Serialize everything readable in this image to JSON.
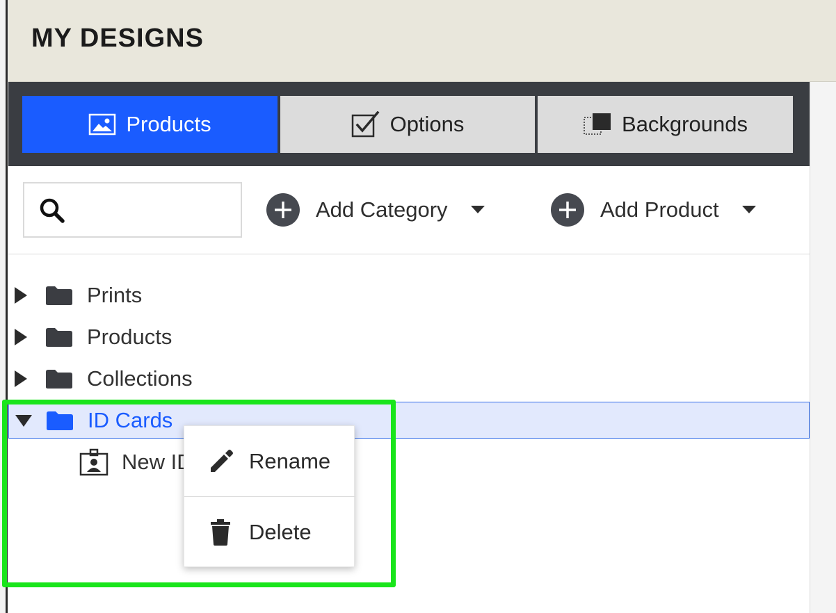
{
  "header": {
    "title": "MY DESIGNS"
  },
  "tabs": [
    {
      "label": "Products",
      "icon": "image-icon",
      "active": true
    },
    {
      "label": "Options",
      "icon": "checkbox-icon",
      "active": false
    },
    {
      "label": "Backgrounds",
      "icon": "layers-icon",
      "active": false
    }
  ],
  "toolbar": {
    "search": {
      "placeholder": "",
      "value": ""
    },
    "add_category_label": "Add Category",
    "add_product_label": "Add Product"
  },
  "tree": {
    "items": [
      {
        "label": "Prints",
        "expanded": false,
        "selected": false
      },
      {
        "label": "Products",
        "expanded": false,
        "selected": false
      },
      {
        "label": "Collections",
        "expanded": false,
        "selected": false
      },
      {
        "label": "ID Cards",
        "expanded": true,
        "selected": true,
        "children": [
          {
            "label": "New ID"
          }
        ]
      }
    ]
  },
  "context_menu": {
    "items": [
      {
        "label": "Rename",
        "icon": "pencil-icon"
      },
      {
        "label": "Delete",
        "icon": "trash-icon"
      }
    ]
  },
  "colors": {
    "accent": "#1a5cff",
    "tab_bar": "#3a3d42",
    "header_bg": "#e9e7dc",
    "highlight": "#19e51b",
    "selected_row": "#e2e9fd"
  }
}
